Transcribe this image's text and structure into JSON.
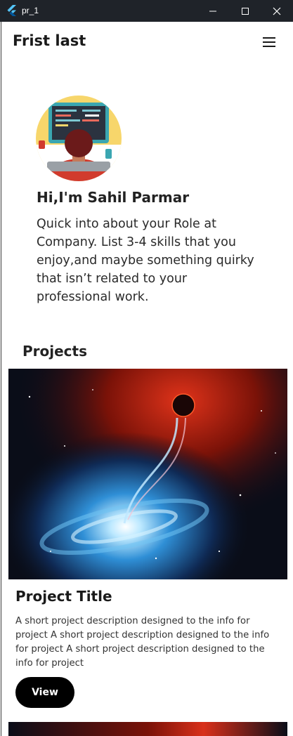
{
  "window": {
    "title": "pr_1"
  },
  "appbar": {
    "title": "Frist last"
  },
  "profile": {
    "greeting": "Hi,I'm Sahil Parmar",
    "intro": "Quick into about your Role at Company. List 3-4 skills that you enjoy,and maybe something quirky that isn’t related to your professional work."
  },
  "projects": {
    "heading": "Projects",
    "items": [
      {
        "title": "Project Title",
        "description": "A short project description designed to the info for project A short project description designed to the info for project A short project description designed to the info for project",
        "button_label": "View"
      }
    ]
  },
  "colors": {
    "titlebar": "#1f2329",
    "button": "#000000",
    "avatar_bg": "#f7d66b",
    "accent_red": "#d13b2d"
  }
}
